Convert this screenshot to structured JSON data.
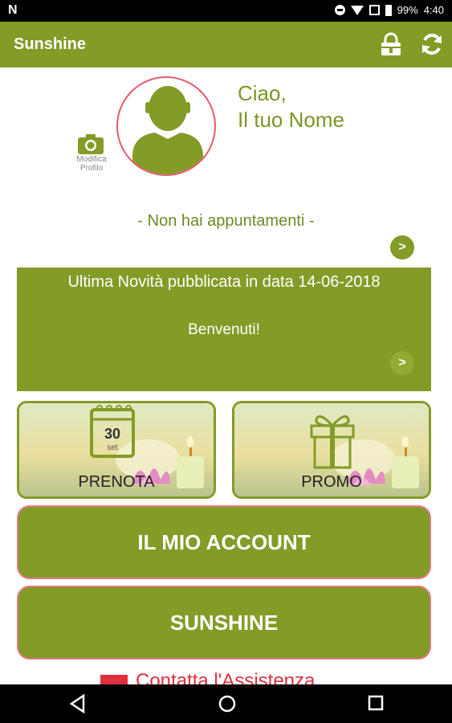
{
  "status_bar": {
    "battery": "99%",
    "time": "4:40"
  },
  "app_bar": {
    "title": "Sunshine",
    "lock_icon": "lock-icon",
    "refresh_icon": "refresh-icon"
  },
  "profile": {
    "edit_label_line1": "Modifica",
    "edit_label_line2": "Profilo",
    "greeting_line1": "Ciao,",
    "greeting_line2": "Il tuo Nome"
  },
  "appointments": {
    "text": "- Non hai appuntamenti -"
  },
  "news": {
    "headline": "Ultima Novità pubblicata in data 14-06-2018",
    "body": "Benvenuti!"
  },
  "tiles": [
    {
      "label": "PRENOTA",
      "icon": "calendar-icon",
      "calendar_text": "30",
      "calendar_sub": "set"
    },
    {
      "label": "PROMO",
      "icon": "gift-icon"
    }
  ],
  "buttons": {
    "account": "IL MIO ACCOUNT",
    "sunshine": "SUNSHINE"
  },
  "contact": {
    "text": "Contatta l'Assistenza"
  },
  "colors": {
    "primary": "#839b27",
    "accent_red": "#e0303d",
    "outline_pink": "#e47a86"
  }
}
